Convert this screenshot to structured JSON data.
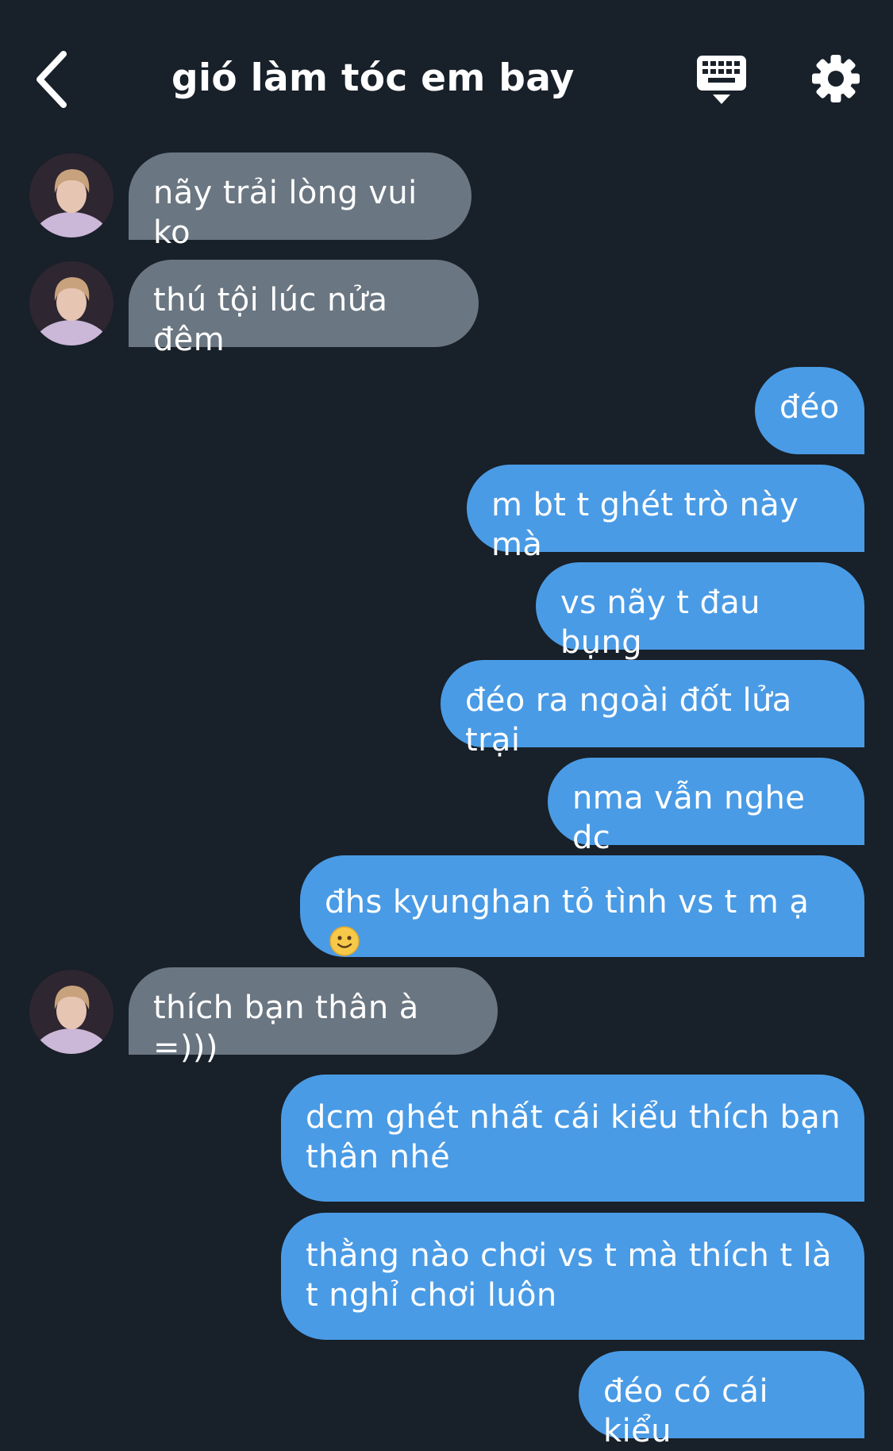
{
  "header": {
    "title": "gió làm tóc em bay",
    "back_icon": "chevron-left-icon",
    "keyboard_icon": "keyboard-icon",
    "settings_icon": "gear-icon"
  },
  "messages": [
    {
      "sender": "them",
      "text": "nãy trải lòng vui ko"
    },
    {
      "sender": "them",
      "text": "thú tội lúc nửa đêm"
    },
    {
      "sender": "me",
      "text": "đéo"
    },
    {
      "sender": "me",
      "text": "m bt t ghét trò này mà"
    },
    {
      "sender": "me",
      "text": "vs nãy t đau bụng"
    },
    {
      "sender": "me",
      "text": "đéo ra ngoài đốt lửa trại"
    },
    {
      "sender": "me",
      "text": "nma vẫn nghe dc"
    },
    {
      "sender": "me",
      "text": "đhs kyunghan tỏ tình vs t m ạ",
      "emoji": "🙂"
    },
    {
      "sender": "them",
      "text": "thích bạn thân à =)))"
    },
    {
      "sender": "me",
      "text": "dcm ghét nhất cái kiểu thích bạn thân nhé"
    },
    {
      "sender": "me",
      "text": "thằng nào chơi vs t mà thích t là t nghỉ chơi luôn"
    },
    {
      "sender": "me",
      "text": "đéo có cái kiểu"
    }
  ],
  "colors": {
    "background": "#182029",
    "incoming_bubble": "#6a7681",
    "outgoing_bubble": "#4a9be5",
    "text": "#ffffff"
  }
}
